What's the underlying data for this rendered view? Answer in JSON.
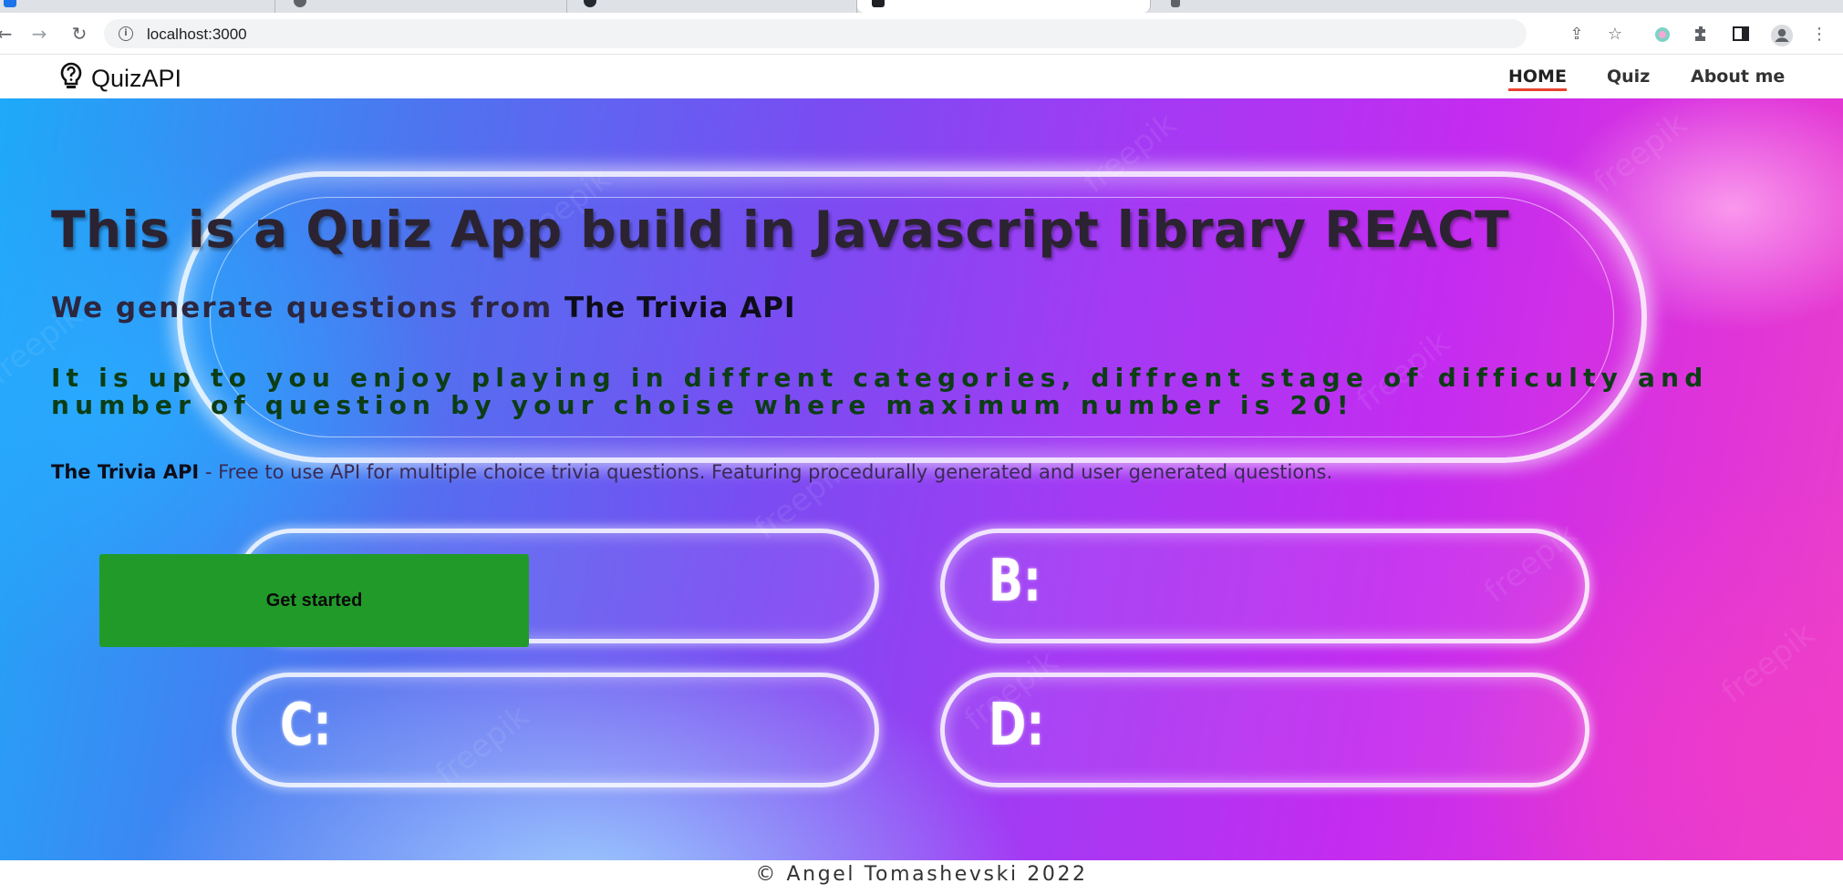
{
  "browser": {
    "url": "localhost:3000"
  },
  "navbar": {
    "brand": "QuizAPI",
    "links": [
      {
        "label": "HOME",
        "active": true
      },
      {
        "label": "Quiz",
        "active": false
      },
      {
        "label": "About me",
        "active": false
      }
    ]
  },
  "hero": {
    "title": "This is a Quiz App build in Javascript library REACT",
    "subtitle_prefix": "We generate questions from",
    "subtitle_source": "The Trivia API",
    "description": "It is up to you enjoy playing in diffrent categories, diffrent stage of difficulty and number of question by your choise where maximum number is 20!",
    "info_name": "The Trivia API",
    "info_text": " - Free to use API for multiple choice trivia questions. Featuring procedurally generated and user generated questions.",
    "start_button": "Get started",
    "answer_labels": {
      "b": "B:",
      "c": "C:",
      "d": "D:"
    },
    "watermark": "freepik"
  },
  "footer": {
    "text": "© Angel Tomashevski 2022"
  },
  "colors": {
    "accent_underline": "#e8432f",
    "start_button": "#229a2a",
    "description_text": "#0c3d14"
  }
}
